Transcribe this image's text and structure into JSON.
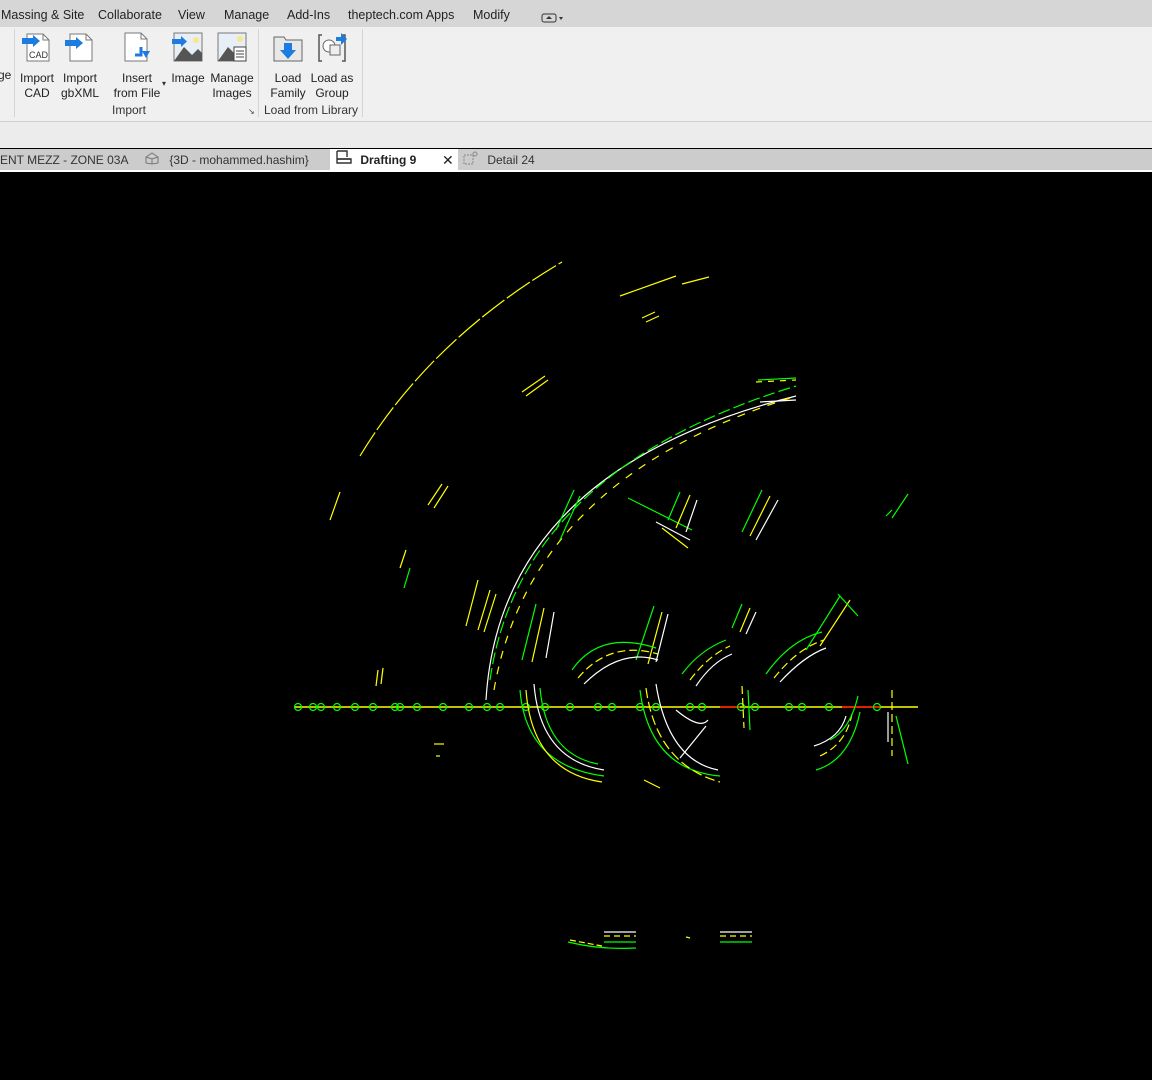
{
  "menubar": {
    "items": [
      "Massing & Site",
      "Collaborate",
      "View",
      "Manage",
      "Add-Ins",
      "theptech.com Apps",
      "Modify"
    ],
    "extra_icon": "ribbon-toggle-icon"
  },
  "ribbon": {
    "partial_left_label": "ge",
    "buttons": [
      {
        "line1": "Import",
        "line2": "CAD",
        "icon": "import-cad-icon",
        "icon_text": "CAD"
      },
      {
        "line1": "Import",
        "line2": "gbXML",
        "icon": "import-gbxml-icon"
      },
      {
        "line1": "Insert",
        "line2": "from File",
        "icon": "insert-from-file-icon"
      },
      {
        "line1": "Image",
        "line2": "",
        "icon": "image-icon"
      },
      {
        "line1": "Manage",
        "line2": "Images",
        "icon": "manage-images-icon"
      },
      {
        "line1": "Load",
        "line2": "Family",
        "icon": "load-family-icon"
      },
      {
        "line1": "Load as",
        "line2": "Group",
        "icon": "load-as-group-icon"
      }
    ],
    "panels": [
      {
        "label": "Import"
      },
      {
        "label": "Load from Library"
      }
    ]
  },
  "tabs": [
    {
      "label": "ENT MEZZ - ZONE 03A",
      "icon": "",
      "active": false
    },
    {
      "label": "{3D - mohammed.hashim}",
      "icon": "3d-view-icon",
      "active": false
    },
    {
      "label": "Drafting 9",
      "icon": "drafting-view-icon",
      "active": true
    },
    {
      "label": "Detail 24",
      "icon": "detail-view-icon",
      "active": false
    }
  ],
  "canvas": {
    "background": "#000000",
    "line_colors": {
      "yellow": "#ffff00",
      "green": "#00ff00",
      "white": "#ffffff",
      "red": "#ff0000",
      "gray": "#999999"
    }
  }
}
